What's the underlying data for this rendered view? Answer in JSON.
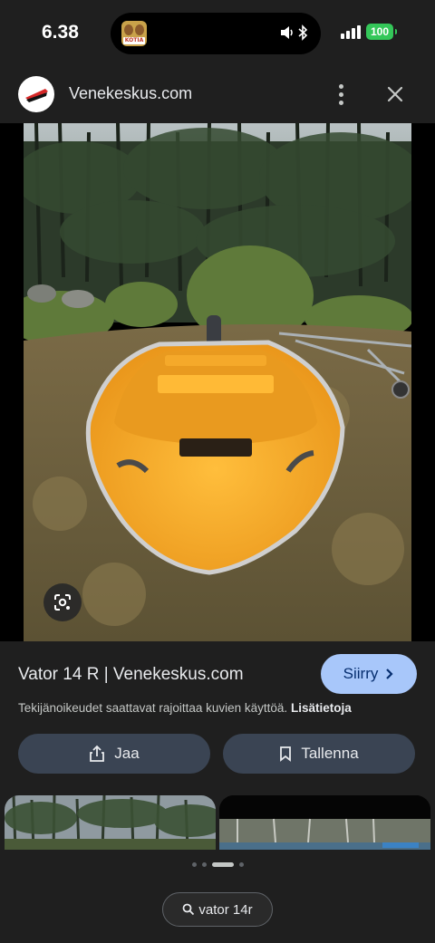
{
  "status_bar": {
    "time": "6.38",
    "battery": "100",
    "island_app_label": "KOTIA"
  },
  "header": {
    "site_name": "Venekeskus.com",
    "logo_icon": "boat-logo-icon",
    "more_icon": "more-vert-icon",
    "close_icon": "close-icon"
  },
  "image": {
    "lens_icon": "google-lens-icon"
  },
  "info": {
    "title": "Vator 14 R | Venekeskus.com",
    "visit_label": "Siirry",
    "copyright_text": "Tekijänoikeudet saattavat rajoittaa kuvien käyttöä.",
    "more_info_link": "Lisätietoja",
    "share_label": "Jaa",
    "save_label": "Tallenna"
  },
  "related": {
    "page_indicator": {
      "total": 4,
      "active": 2
    }
  },
  "search_chip": {
    "query": "vator 14r"
  },
  "colors": {
    "background": "#1f1f1f",
    "visit_button": "#a8c7fa",
    "action_button": "#3a4453",
    "battery": "#34c759",
    "boat": "#f2a622"
  }
}
